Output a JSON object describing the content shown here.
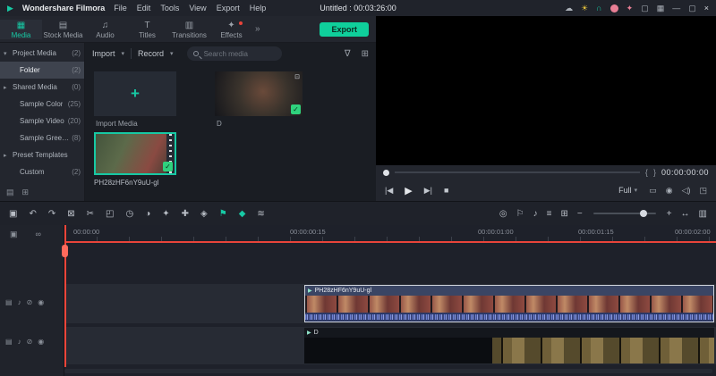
{
  "colors": {
    "accent": "#17C9A4",
    "export_green": "#0FCF9B",
    "red_line": "#E8443A",
    "check_green": "#2FD27D",
    "waveform_blue": "#5D72BD",
    "clip_title_blue": "#3A4564"
  },
  "menubar": {
    "brand": "Wondershare Filmora",
    "menus": [
      "File",
      "Edit",
      "Tools",
      "View",
      "Export",
      "Help"
    ],
    "title": "Untitled : 00:03:26:00"
  },
  "tabs": [
    {
      "label": "Media"
    },
    {
      "label": "Stock Media"
    },
    {
      "label": "Audio"
    },
    {
      "label": "Titles"
    },
    {
      "label": "Transitions"
    },
    {
      "label": "Effects"
    }
  ],
  "tabbar": {
    "export_label": "Export"
  },
  "sidebar": {
    "items": [
      {
        "arrow": "▾",
        "label": "Project Media",
        "count": "(2)"
      },
      {
        "arrow": "",
        "label": "Folder",
        "count": "(2)"
      },
      {
        "arrow": "▸",
        "label": "Shared Media",
        "count": "(0)"
      },
      {
        "arrow": "",
        "label": "Sample Color",
        "count": "(25)"
      },
      {
        "arrow": "",
        "label": "Sample Video",
        "count": "(20)"
      },
      {
        "arrow": "",
        "label": "Sample Green Screen",
        "count": "(8)"
      },
      {
        "arrow": "▸",
        "label": "Preset Templates",
        "count": ""
      },
      {
        "arrow": "",
        "label": "Custom",
        "count": "(2)"
      }
    ]
  },
  "media_panel": {
    "import_label": "Import",
    "record_label": "Record",
    "search_placeholder": "Search media",
    "import_tile_caption": "Import Media",
    "video_tile_caption": "D",
    "selected_clip_name": "PH28zHF6nY9uU-gl"
  },
  "preview": {
    "timecode": "00:00:00:00",
    "quality": "Full"
  },
  "timeline": {
    "ruler_labels": [
      "00:00:00",
      "00:00:00:15",
      "00:00:01:00",
      "00:00:01:15",
      "00:00:02:00"
    ],
    "clip1_name": "PH28zHF6nY9uU-gl",
    "clip2_name": "D"
  },
  "icons": {
    "logo": "▶",
    "cloud": "☁",
    "bulb": "☀",
    "headset": "∩",
    "gift": "✦",
    "layout": "▦",
    "device": "▢",
    "minimize": "—",
    "maximize": "▢",
    "close": "×",
    "tab_media": "▦",
    "tab_stock": "▤",
    "tab_audio": "♫",
    "tab_titles": "T",
    "tab_transitions": "▥",
    "tab_effects": "✦",
    "chevrons": "»",
    "caret": "▾",
    "filter": "∇",
    "grid": "⊞",
    "plus": "+",
    "tile_badge": "⊡",
    "check": "✓",
    "brace_l": "{",
    "brace_r": "}",
    "prev": "|◀",
    "play": "▶",
    "next": "▶|",
    "stop": "■",
    "display": "▭",
    "snapshot": "◉",
    "speaker": "◁)",
    "fullscreen": "◳",
    "manage": "▣",
    "undo": "↶",
    "redo": "↷",
    "delete": "⊠",
    "split": "✂",
    "crop": "◰",
    "speed": "◷",
    "color": "◑",
    "fx": "✦",
    "add": "✚",
    "mask": "◈",
    "marker": "⚑",
    "keyframe": "◆",
    "mixer": "≋",
    "r_track": "◎",
    "r_flag": "⚐",
    "r_mic": "♪",
    "r_list": "≡",
    "r_grid": "⊞",
    "minus": "−",
    "fit": "↔",
    "panels": "▥",
    "layers": "▣",
    "link": "∞",
    "trk_menu": "▤",
    "trk_audio": "♪",
    "trk_lock": "⊘",
    "trk_eye": "◉",
    "film": "▶"
  }
}
